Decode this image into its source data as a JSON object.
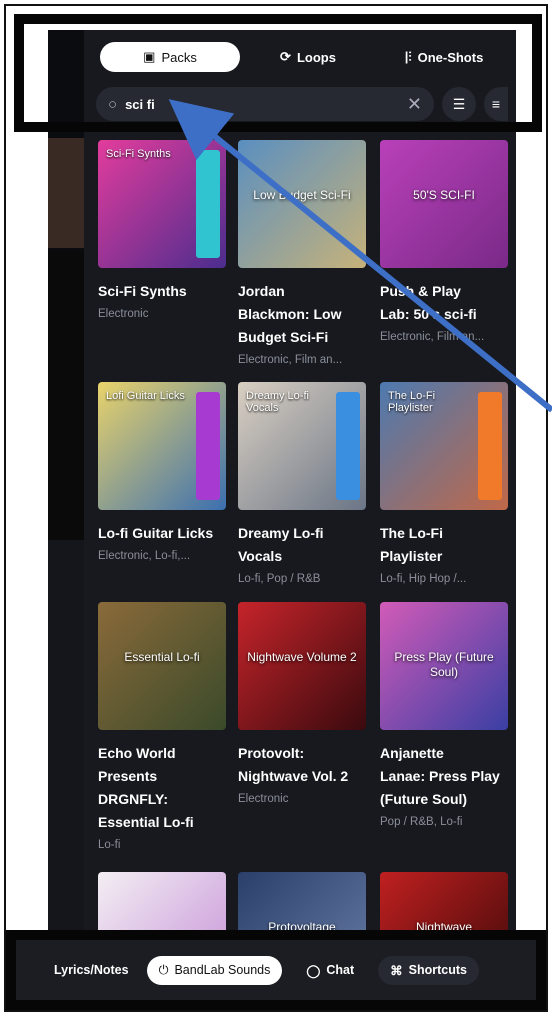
{
  "tabs": [
    {
      "label": "Packs",
      "icon": "packs-icon",
      "active": true
    },
    {
      "label": "Loops",
      "icon": "loop-icon",
      "active": false
    },
    {
      "label": "One-Shots",
      "icon": "waveform-icon",
      "active": false
    }
  ],
  "search": {
    "value": "sci fi",
    "clear_glyph": "✕"
  },
  "packs": [
    {
      "title_lines": [
        "Sci-Fi Synths"
      ],
      "genre": "Electronic",
      "art_label": "Sci-Fi Synths",
      "colors": [
        "#e33c9c",
        "#4b2d8e"
      ],
      "strip": "#2fc4d0"
    },
    {
      "title_lines": [
        "Jordan",
        "Blackmon: Low",
        "Budget Sci-Fi"
      ],
      "genre": "Electronic, Film an...",
      "art_label": "Low Budget Sci-Fi",
      "colors": [
        "#5a8fc0",
        "#c6b27a"
      ],
      "strip": ""
    },
    {
      "title_lines": [
        "Push & Play",
        "Lab: 50's sci-fi"
      ],
      "genre": "Electronic, Film an...",
      "art_label": "50'S SCI-FI",
      "colors": [
        "#b940b9",
        "#7a2a88"
      ],
      "strip": ""
    },
    {
      "title_lines": [
        "Lo-fi Guitar Licks"
      ],
      "genre": "Electronic, Lo-fi,...",
      "art_label": "Lofi Guitar Licks",
      "colors": [
        "#e9d36b",
        "#3b6fb0"
      ],
      "strip": "#a73ad1"
    },
    {
      "title_lines": [
        "Dreamy Lo-fi",
        "Vocals"
      ],
      "genre": "Lo-fi, Pop / R&B",
      "art_label": "Dreamy Lo-fi Vocals",
      "colors": [
        "#d9cfc2",
        "#6a7586"
      ],
      "strip": "#3a8fe0"
    },
    {
      "title_lines": [
        "The Lo-Fi",
        "Playlister"
      ],
      "genre": "Lo-fi, Hip Hop /...",
      "art_label": "The Lo-Fi Playlister",
      "colors": [
        "#4d7ab0",
        "#c06848"
      ],
      "strip": "#f07a2a"
    },
    {
      "title_lines": [
        "Echo World",
        "Presents",
        "DRGNFLY:",
        "Essential Lo-fi"
      ],
      "genre": "Lo-fi",
      "art_label": "Essential Lo-fi",
      "colors": [
        "#8a6a3a",
        "#3a4a2a"
      ],
      "strip": ""
    },
    {
      "title_lines": [
        "Protovolt:",
        "Nightwave Vol. 2"
      ],
      "genre": "Electronic",
      "art_label": "Nightwave Volume 2",
      "colors": [
        "#c5242a",
        "#3a0a0e"
      ],
      "strip": ""
    },
    {
      "title_lines": [
        "Anjanette",
        "Lanae: Press Play",
        "(Future Soul)"
      ],
      "genre": "Pop / R&B, Lo-fi",
      "art_label": "Press Play (Future Soul)",
      "colors": [
        "#d25bb8",
        "#3a3fa3"
      ],
      "strip": ""
    },
    {
      "title_lines": [],
      "genre": "",
      "art_label": "",
      "colors": [
        "#f3eef3",
        "#c48ed6"
      ],
      "strip": ""
    },
    {
      "title_lines": [],
      "genre": "",
      "art_label": "Protovoltage",
      "colors": [
        "#2a3f6a",
        "#6a7fa8"
      ],
      "strip": ""
    },
    {
      "title_lines": [],
      "genre": "",
      "art_label": "Nightwave",
      "colors": [
        "#c02020",
        "#3a0808"
      ],
      "strip": ""
    }
  ],
  "footer": {
    "lyrics": "Lyrics/Notes",
    "bandlab": "BandLab Sounds",
    "chat": "Chat",
    "shortcuts": "Shortcuts"
  },
  "colors": {
    "panel_bg": "#17191f",
    "annotation_arrow": "#3e6fc7"
  }
}
